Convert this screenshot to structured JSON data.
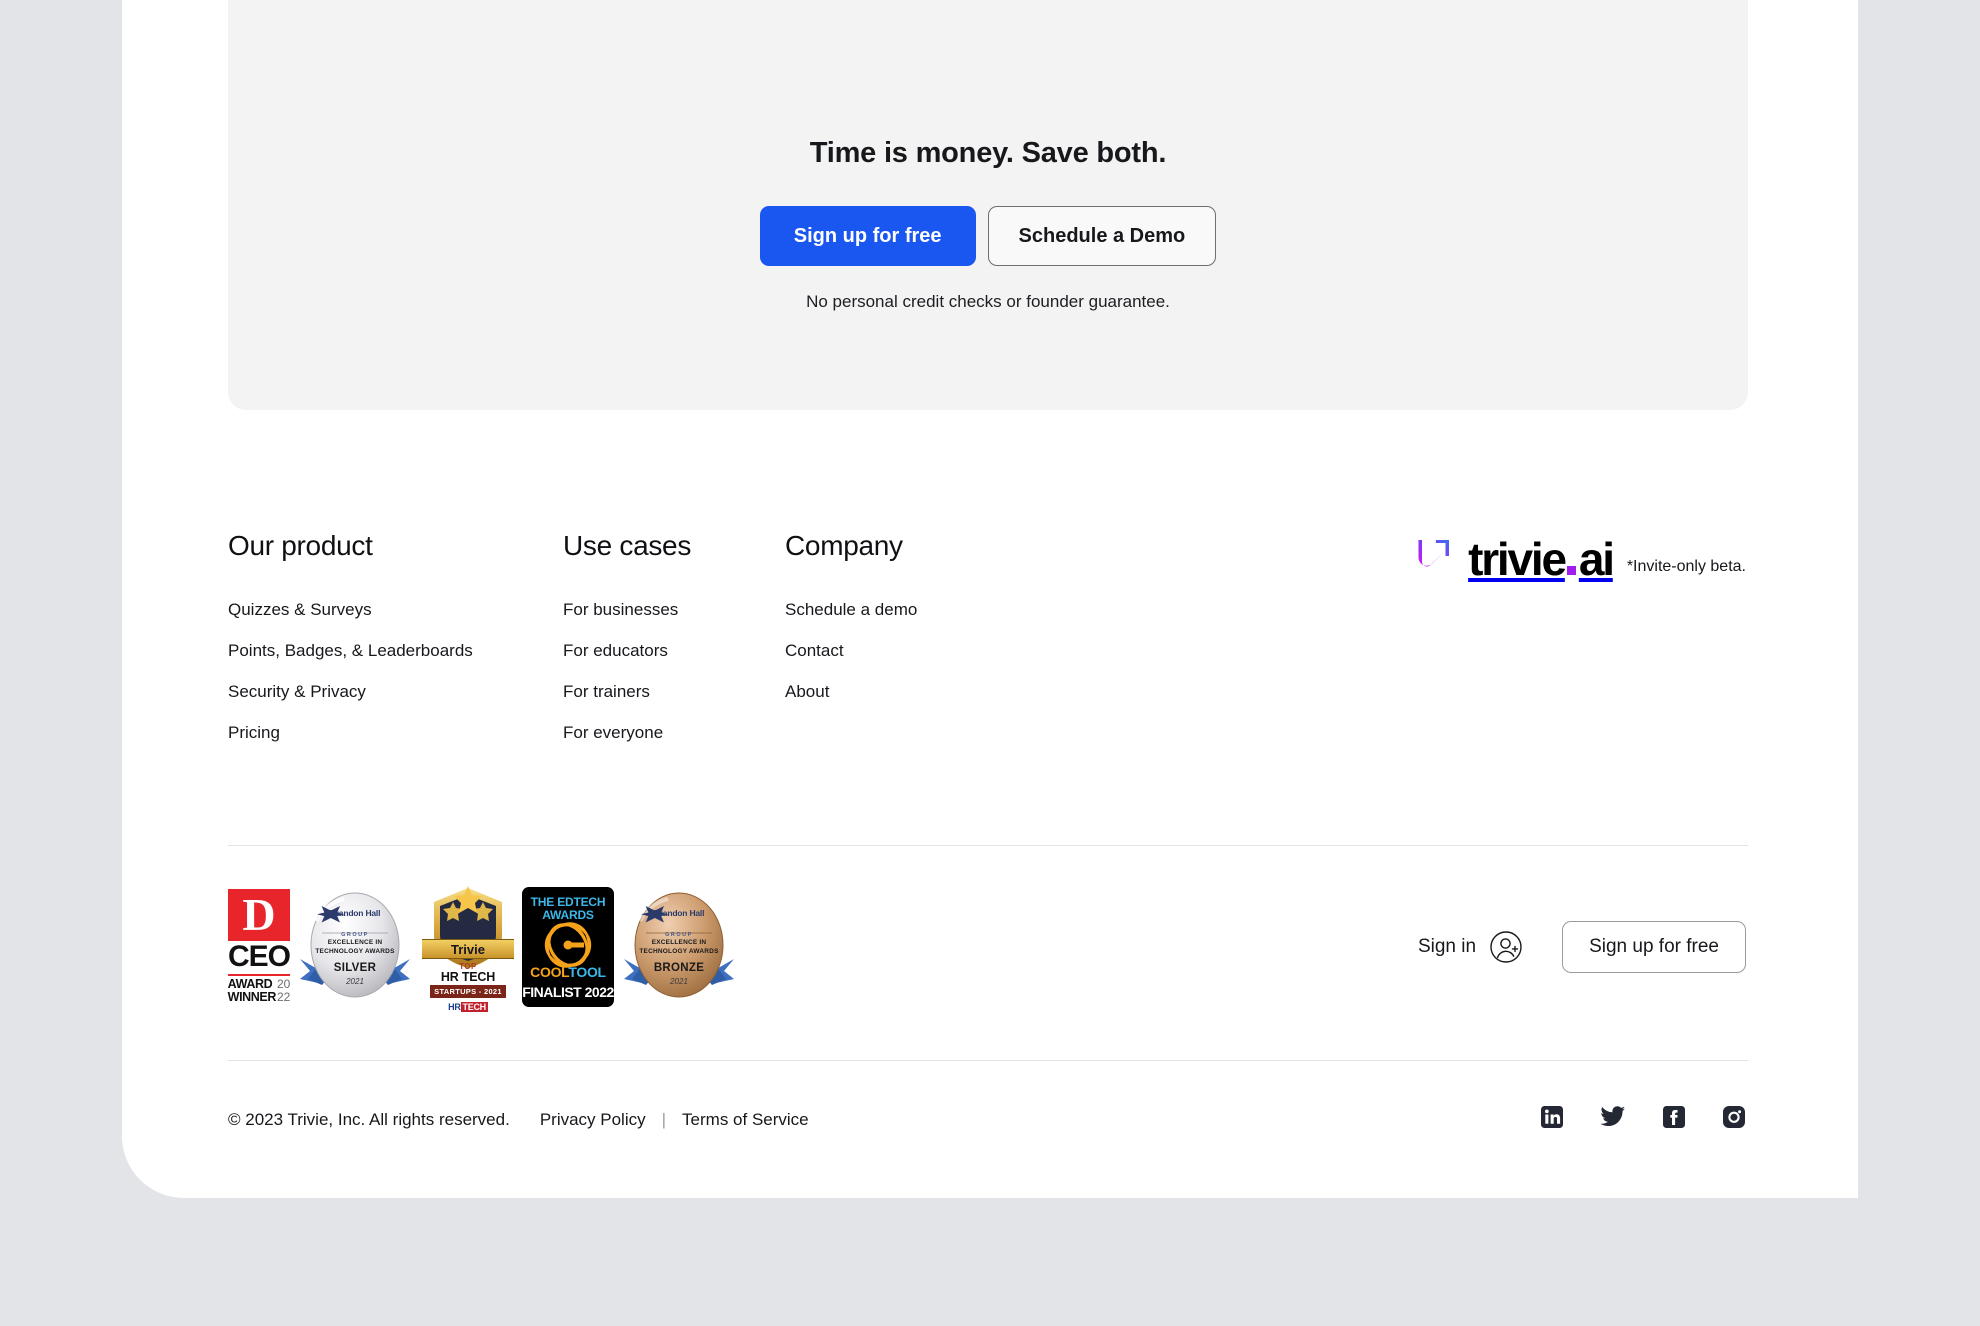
{
  "cta": {
    "title": "Time is money. Save both.",
    "primary_button": "Sign up for free",
    "secondary_button": "Schedule a Demo",
    "note": "No personal credit checks or founder guarantee.",
    "panel_color": "#f3f3f3",
    "primary_color": "#1a56f0"
  },
  "footer": {
    "columns": [
      {
        "heading": "Our product",
        "links": [
          "Quizzes & Surveys",
          "Points, Badges, & Leaderboards",
          "Security & Privacy",
          "Pricing"
        ]
      },
      {
        "heading": "Use cases",
        "links": [
          "For businesses",
          "For educators",
          "For trainers",
          "For everyone"
        ]
      },
      {
        "heading": "Company",
        "links": [
          "Schedule a demo",
          "Contact",
          "About"
        ]
      }
    ]
  },
  "brand": {
    "logo_text_1": "trivie",
    "logo_text_2": "ai",
    "beta_note": "*Invite-only beta.",
    "gradient_start": "#d21ef0",
    "gradient_end": "#3a6df2",
    "dot_color": "#a21cf0"
  },
  "awards": [
    {
      "name": "d-ceo-award",
      "letter": "D",
      "title": "CEO",
      "line1": "AWARD",
      "line2": "WINNER",
      "year_top": "20",
      "year_bottom": "22",
      "accent": "#e8252a"
    },
    {
      "name": "brandon-hall-silver",
      "brand": "Brandon Hall",
      "group": "GROUP",
      "subtitle_1": "EXCELLENCE IN",
      "subtitle_2": "TECHNOLOGY AWARDS",
      "level": "SILVER",
      "year": "2021",
      "medal_light": "#f2f2f2",
      "medal_dark": "#b9b9bd"
    },
    {
      "name": "top-hr-tech-startups",
      "ribbon": "Trivie",
      "top": "TOP",
      "category": "HR TECH",
      "startups": "STARTUPS - 2021",
      "logo_a": "HR",
      "logo_b": "TECH"
    },
    {
      "name": "edtech-cool-tool-finalist",
      "line1": "THE EDTECH",
      "line2": "AWARDS",
      "cool": "COOL",
      "tool": "TOOL",
      "finalist": "FINALIST 2022"
    },
    {
      "name": "brandon-hall-bronze",
      "brand": "Brandon Hall",
      "group": "GROUP",
      "subtitle_1": "EXCELLENCE IN",
      "subtitle_2": "TECHNOLOGY AWARDS",
      "level": "BRONZE",
      "year": "2021",
      "medal_light": "#d9ac84",
      "medal_dark": "#a1713f"
    }
  ],
  "auth": {
    "signin_label": "Sign in",
    "signin_icon": "user-plus-circle-icon",
    "signup_label": "Sign up for free"
  },
  "legal": {
    "copyright": "© 2023 Trivie, Inc. All rights reserved.",
    "privacy": "Privacy Policy",
    "separator": "|",
    "terms": "Terms of Service"
  },
  "socials": [
    {
      "name": "linkedin-icon",
      "label": "LinkedIn"
    },
    {
      "name": "twitter-icon",
      "label": "Twitter"
    },
    {
      "name": "facebook-icon",
      "label": "Facebook"
    },
    {
      "name": "instagram-icon",
      "label": "Instagram"
    }
  ]
}
